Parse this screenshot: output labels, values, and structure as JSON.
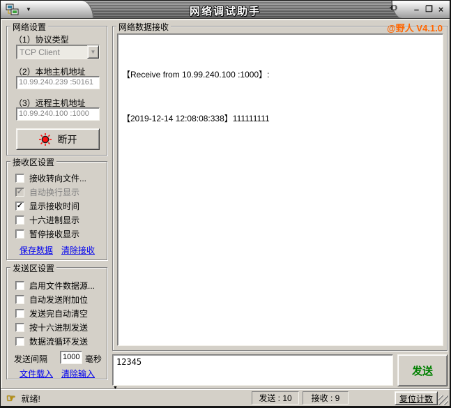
{
  "titlebar": {
    "title": "网络调试助手",
    "dropdown_glyph": "▼",
    "minimize_glyph": "–",
    "maximize_glyph": "❐",
    "close_glyph": "×"
  },
  "network_settings": {
    "title": "网络设置",
    "protocol_label": "（1）协议类型",
    "protocol_value": "TCP Client",
    "local_label": "（2）本地主机地址",
    "local_value": "10.99.240.239 :50161",
    "remote_label": "（3）远程主机地址",
    "remote_value": "10.99.240.100 :1000",
    "disconnect_button": "断开"
  },
  "receive_settings": {
    "title": "接收区设置",
    "options": [
      {
        "label": "接收转向文件...",
        "checked": false,
        "disabled": false
      },
      {
        "label": "自动换行显示",
        "checked": true,
        "disabled": true
      },
      {
        "label": "显示接收时间",
        "checked": true,
        "disabled": false
      },
      {
        "label": "十六进制显示",
        "checked": false,
        "disabled": false
      },
      {
        "label": "暂停接收显示",
        "checked": false,
        "disabled": false
      }
    ],
    "links": [
      "保存数据",
      "清除接收"
    ]
  },
  "send_settings": {
    "title": "发送区设置",
    "options": [
      {
        "label": "启用文件数据源...",
        "checked": false
      },
      {
        "label": "自动发送附加位",
        "checked": false
      },
      {
        "label": "发送完自动清空",
        "checked": false
      },
      {
        "label": "按十六进制发送",
        "checked": false
      },
      {
        "label": "数据流循环发送",
        "checked": false
      }
    ],
    "interval_label": "发送间隔",
    "interval_value": "1000",
    "interval_unit": "毫秒",
    "links": [
      "文件载入",
      "清除输入"
    ]
  },
  "receive_area": {
    "title": "网络数据接收",
    "version": "@野人 V4.1.0",
    "lines": [
      "【Receive from 10.99.240.100 :1000】:",
      "【2019-12-14 12:08:08:338】111111111"
    ]
  },
  "send_area": {
    "input_value": "12345",
    "send_button": "发送"
  },
  "status_bar": {
    "ready_text": "就绪!",
    "sent_counter": "发送 : 10",
    "recv_counter": "接收 : 9",
    "reset_button": "复位计数"
  },
  "glyphs": {
    "check": "✓",
    "combo_arrow": "▼",
    "splitter_arrow": "▼",
    "hand": "☞"
  },
  "colors": {
    "background": "#d4d0c8",
    "accent_orange": "#ff6600",
    "link_blue": "#0000ee",
    "send_green": "#008000",
    "led_red": "#ff1010"
  }
}
